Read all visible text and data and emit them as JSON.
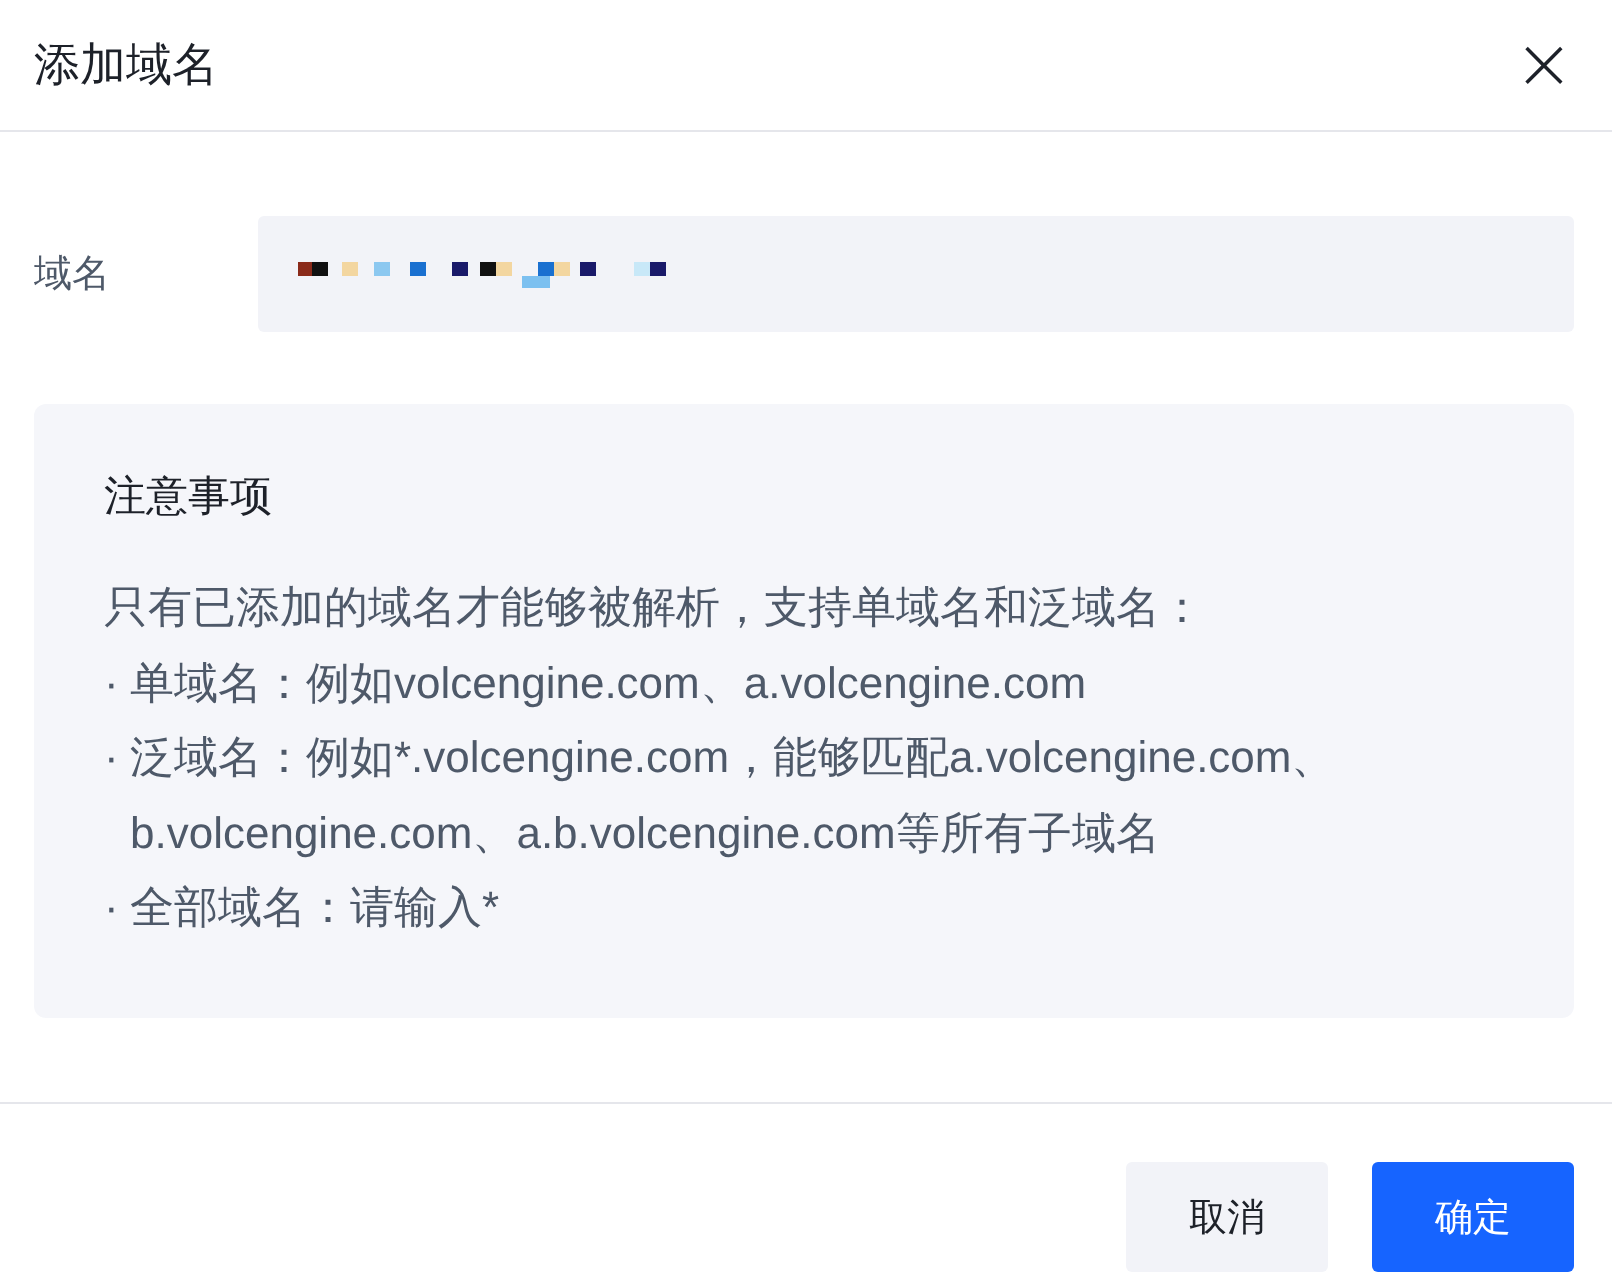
{
  "dialog": {
    "title": "添加域名",
    "close": "×"
  },
  "field": {
    "label": "域名",
    "redacted": true
  },
  "notice": {
    "title": "注意事项",
    "intro": "只有已添加的域名才能够被解析，支持单域名和泛域名：",
    "items": [
      {
        "bullet": "·",
        "lines": [
          "单域名：例如volcengine.com、a.volcengine.com"
        ]
      },
      {
        "bullet": "·",
        "lines": [
          "泛域名：例如*.volcengine.com，能够匹配a.volcengine.com、",
          "b.volcengine.com、a.b.volcengine.com等所有子域名"
        ]
      },
      {
        "bullet": "·",
        "lines": [
          "全部域名：请输入*"
        ]
      }
    ]
  },
  "buttons": [
    {
      "label": "取消",
      "kind": "secondary"
    },
    {
      "label": "确定",
      "kind": "primary"
    }
  ]
}
